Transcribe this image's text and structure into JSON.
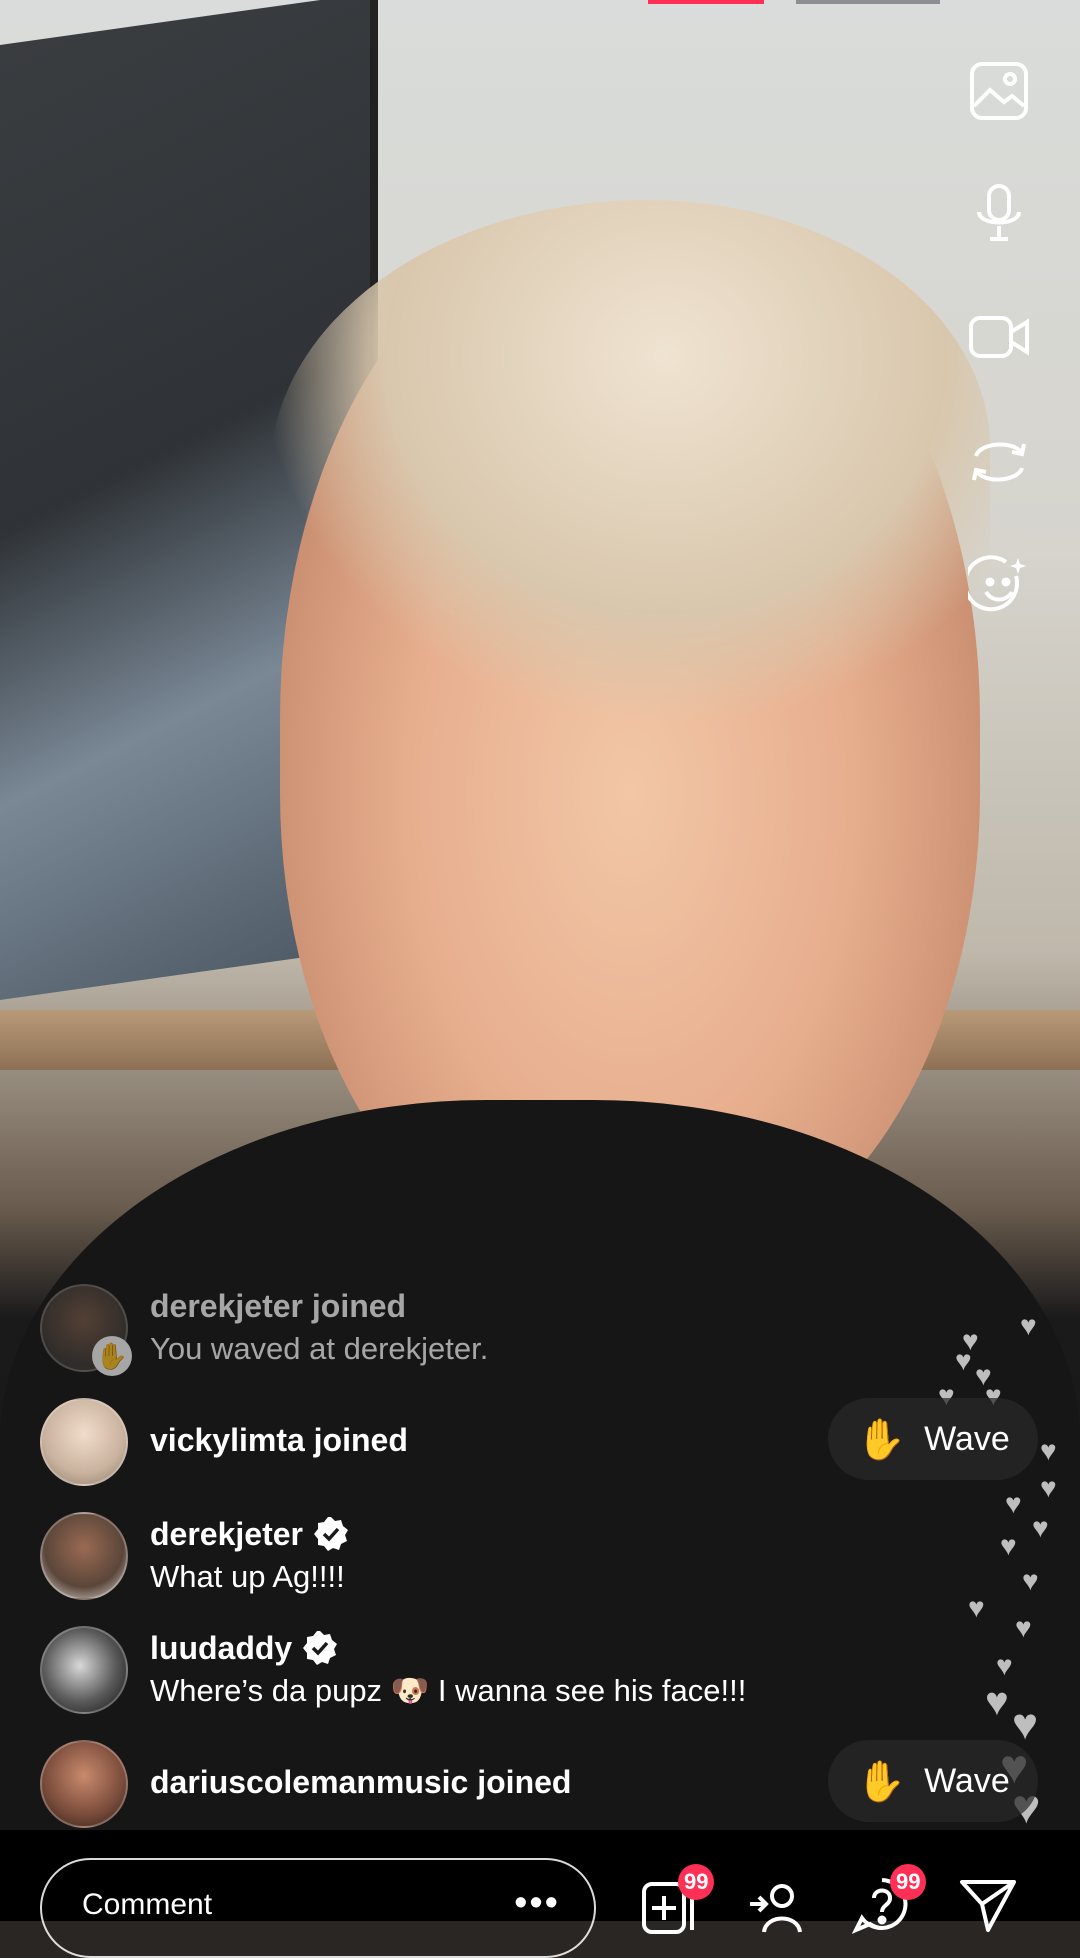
{
  "colors": {
    "accent_red": "#ff2f56",
    "wave_hand": "#f3b63b",
    "verified_blue": "#ffffff"
  },
  "tools": [
    {
      "name": "gallery-icon"
    },
    {
      "name": "microphone-icon"
    },
    {
      "name": "video-camera-icon"
    },
    {
      "name": "flip-camera-icon"
    },
    {
      "name": "effects-icon"
    }
  ],
  "feed": [
    {
      "username": "derekjeter joined",
      "message": "You waved at derekjeter.",
      "verified": false,
      "faded": true,
      "badge": "wave-icon"
    },
    {
      "username": "vickylimta joined",
      "message": "",
      "verified": false,
      "faded": false,
      "wave_button": "Wave"
    },
    {
      "username": "derekjeter",
      "message": "What up Ag!!!!",
      "verified": true,
      "faded": false
    },
    {
      "username": "luudaddy",
      "message": "Where’s da pupz 🐶 I wanna see his face!!!",
      "verified": true,
      "faded": false
    },
    {
      "username": "dariuscolemanmusic joined",
      "message": "",
      "verified": false,
      "faded": false,
      "wave_button": "Wave"
    }
  ],
  "bottom": {
    "comment_placeholder": "Comment",
    "more_label": "•••",
    "add_badge": "99",
    "questions_badge": "99"
  }
}
